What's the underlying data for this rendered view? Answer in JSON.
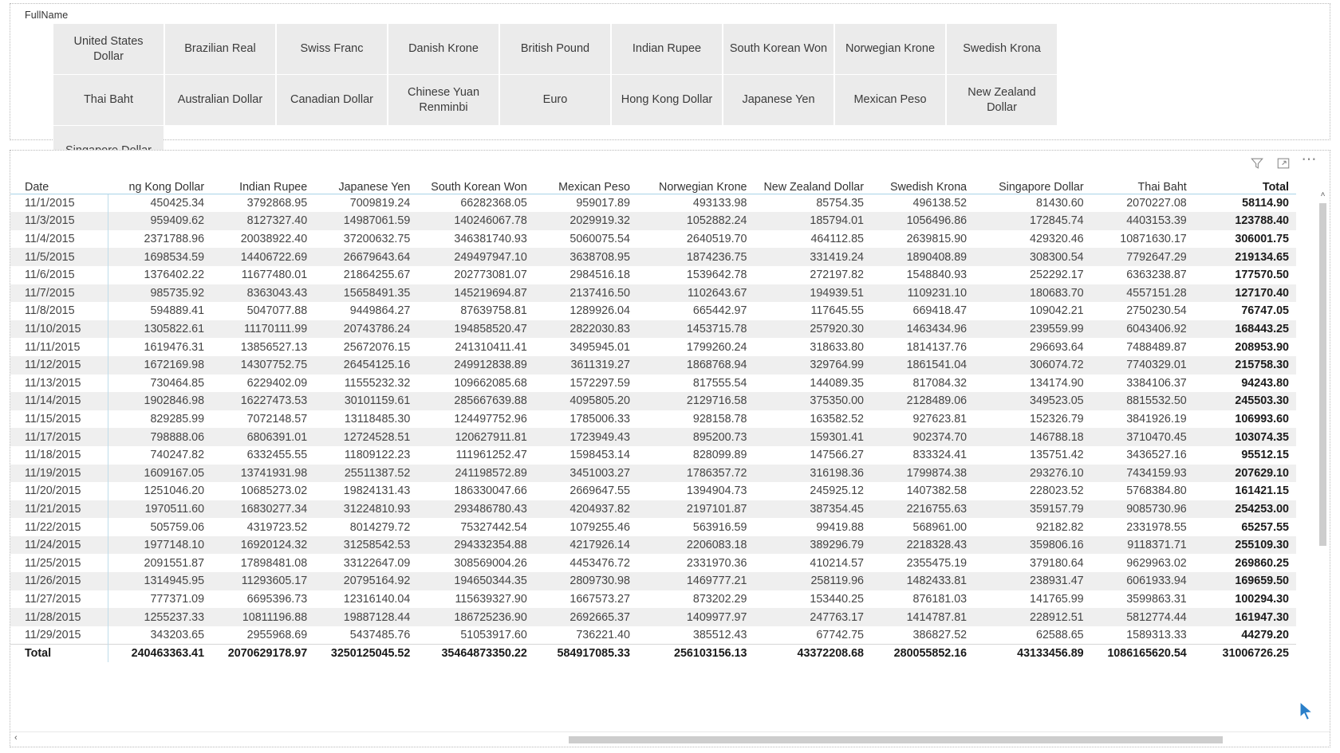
{
  "slicer": {
    "title": "FullName",
    "items": [
      "United States Dollar",
      "Brazilian Real",
      "Swiss Franc",
      "Danish Krone",
      "British Pound",
      "Indian Rupee",
      "South Korean Won",
      "Norwegian Krone",
      "Swedish Krona",
      "Thai Baht",
      "Australian Dollar",
      "Canadian Dollar",
      "Chinese Yuan Renminbi",
      "Euro",
      "Hong Kong Dollar",
      "Japanese Yen",
      "Mexican Peso",
      "New Zealand Dollar",
      "Singapore Dollar"
    ]
  },
  "toolbar": {
    "filter_icon": "filter-icon",
    "focus_icon": "focus-mode-icon",
    "more_icon": "more-options-icon"
  },
  "table": {
    "columns": [
      "Date",
      "ng Kong Dollar",
      "Indian Rupee",
      "Japanese Yen",
      "South Korean Won",
      "Mexican Peso",
      "Norwegian Krone",
      "New Zealand Dollar",
      "Swedish Krona",
      "Singapore Dollar",
      "Thai Baht",
      "Total"
    ],
    "rows": [
      [
        "11/1/2015",
        "450425.34",
        "3792868.95",
        "7009819.24",
        "66282368.05",
        "959017.89",
        "493133.98",
        "85754.35",
        "496138.52",
        "81430.60",
        "2070227.08",
        "58114.90"
      ],
      [
        "11/3/2015",
        "959409.62",
        "8127327.40",
        "14987061.59",
        "140246067.78",
        "2029919.32",
        "1052882.24",
        "185794.01",
        "1056496.86",
        "172845.74",
        "4403153.39",
        "123788.40"
      ],
      [
        "11/4/2015",
        "2371788.96",
        "20038922.40",
        "37200632.75",
        "346381740.93",
        "5060075.54",
        "2640519.70",
        "464112.85",
        "2639815.90",
        "429320.46",
        "10871630.17",
        "306001.75"
      ],
      [
        "11/5/2015",
        "1698534.59",
        "14406722.69",
        "26679643.64",
        "249497947.10",
        "3638708.95",
        "1874236.75",
        "331419.24",
        "1890408.89",
        "308300.54",
        "7792647.29",
        "219134.65"
      ],
      [
        "11/6/2015",
        "1376402.22",
        "11677480.01",
        "21864255.67",
        "202773081.07",
        "2984516.18",
        "1539642.78",
        "272197.82",
        "1548840.93",
        "252292.17",
        "6363238.87",
        "177570.50"
      ],
      [
        "11/7/2015",
        "985735.92",
        "8363043.43",
        "15658491.35",
        "145219694.87",
        "2137416.50",
        "1102643.67",
        "194939.51",
        "1109231.10",
        "180683.70",
        "4557151.28",
        "127170.40"
      ],
      [
        "11/8/2015",
        "594889.41",
        "5047077.88",
        "9449864.27",
        "87639758.81",
        "1289926.04",
        "665442.97",
        "117645.55",
        "669418.47",
        "109042.21",
        "2750230.54",
        "76747.05"
      ],
      [
        "11/10/2015",
        "1305822.61",
        "11170111.99",
        "20743786.24",
        "194858520.47",
        "2822030.83",
        "1453715.78",
        "257920.30",
        "1463434.96",
        "239559.99",
        "6043406.92",
        "168443.25"
      ],
      [
        "11/11/2015",
        "1619476.31",
        "13856527.13",
        "25672076.15",
        "241310411.41",
        "3495945.01",
        "1799260.24",
        "318633.80",
        "1814137.76",
        "296693.64",
        "7488489.87",
        "208953.90"
      ],
      [
        "11/12/2015",
        "1672169.98",
        "14307752.75",
        "26454125.16",
        "249912838.89",
        "3611319.27",
        "1868768.94",
        "329764.99",
        "1861541.04",
        "306074.72",
        "7740329.01",
        "215758.30"
      ],
      [
        "11/13/2015",
        "730464.85",
        "6229402.09",
        "11555232.32",
        "109662085.68",
        "1572297.59",
        "817555.54",
        "144089.35",
        "817084.32",
        "134174.90",
        "3384106.37",
        "94243.80"
      ],
      [
        "11/14/2015",
        "1902846.98",
        "16227473.53",
        "30101159.61",
        "285667639.88",
        "4095805.20",
        "2129716.58",
        "375350.00",
        "2128489.06",
        "349523.05",
        "8815532.50",
        "245503.30"
      ],
      [
        "11/15/2015",
        "829285.99",
        "7072148.57",
        "13118485.30",
        "124497752.96",
        "1785006.33",
        "928158.78",
        "163582.52",
        "927623.81",
        "152326.79",
        "3841926.19",
        "106993.60"
      ],
      [
        "11/17/2015",
        "798888.06",
        "6806391.01",
        "12724528.51",
        "120627911.81",
        "1723949.43",
        "895200.73",
        "159301.41",
        "902374.70",
        "146788.18",
        "3710470.45",
        "103074.35"
      ],
      [
        "11/18/2015",
        "740247.82",
        "6332455.55",
        "11809122.23",
        "111961252.47",
        "1598453.14",
        "828099.89",
        "147566.27",
        "833324.41",
        "135751.42",
        "3436527.16",
        "95512.15"
      ],
      [
        "11/19/2015",
        "1609167.05",
        "13741931.98",
        "25511387.52",
        "241198572.89",
        "3451003.27",
        "1786357.72",
        "316198.36",
        "1799874.38",
        "293276.10",
        "7434159.93",
        "207629.10"
      ],
      [
        "11/20/2015",
        "1251046.20",
        "10685273.02",
        "19824131.43",
        "186330047.66",
        "2669647.55",
        "1394904.73",
        "245925.12",
        "1407382.58",
        "228023.52",
        "5768384.80",
        "161421.15"
      ],
      [
        "11/21/2015",
        "1970511.60",
        "16830277.34",
        "31224810.93",
        "293486780.43",
        "4204937.82",
        "2197101.87",
        "387354.45",
        "2216755.63",
        "359157.79",
        "9085730.96",
        "254253.00"
      ],
      [
        "11/22/2015",
        "505759.06",
        "4319723.52",
        "8014279.72",
        "75327442.54",
        "1079255.46",
        "563916.59",
        "99419.88",
        "568961.00",
        "92182.82",
        "2331978.55",
        "65257.55"
      ],
      [
        "11/24/2015",
        "1977148.10",
        "16920124.32",
        "31258542.53",
        "294332354.88",
        "4217926.14",
        "2206083.18",
        "389296.79",
        "2218328.43",
        "359806.16",
        "9118371.71",
        "255109.30"
      ],
      [
        "11/25/2015",
        "2091551.87",
        "17898481.08",
        "33122647.09",
        "308569004.26",
        "4453476.72",
        "2331970.36",
        "410214.57",
        "2355475.19",
        "379180.64",
        "9629963.02",
        "269860.25"
      ],
      [
        "11/26/2015",
        "1314945.95",
        "11293605.17",
        "20795164.92",
        "194650344.35",
        "2809730.98",
        "1469777.21",
        "258119.96",
        "1482433.81",
        "238931.47",
        "6061933.94",
        "169659.50"
      ],
      [
        "11/27/2015",
        "777371.09",
        "6695396.73",
        "12316140.04",
        "115639327.90",
        "1667573.27",
        "873202.29",
        "153440.25",
        "876181.03",
        "141765.99",
        "3599863.31",
        "100294.30"
      ],
      [
        "11/28/2015",
        "1255237.33",
        "10811196.88",
        "19887128.44",
        "186725236.90",
        "2692665.37",
        "1409977.97",
        "247763.17",
        "1414787.81",
        "228912.51",
        "5812774.44",
        "161947.30"
      ],
      [
        "11/29/2015",
        "343203.65",
        "2955968.69",
        "5437485.76",
        "51053917.60",
        "736221.40",
        "385512.43",
        "67742.75",
        "386827.52",
        "62588.65",
        "1589313.33",
        "44279.20"
      ]
    ],
    "total_row": [
      "Total",
      "240463363.41",
      "2070629178.97",
      "3250125045.52",
      "35464873350.22",
      "584917085.33",
      "256103156.13",
      "43372208.68",
      "280055852.16",
      "43133456.89",
      "1086165620.54",
      "31006726.25"
    ]
  },
  "scrollbars": {
    "up_arrow": "˄",
    "left_arrow": "‹"
  }
}
